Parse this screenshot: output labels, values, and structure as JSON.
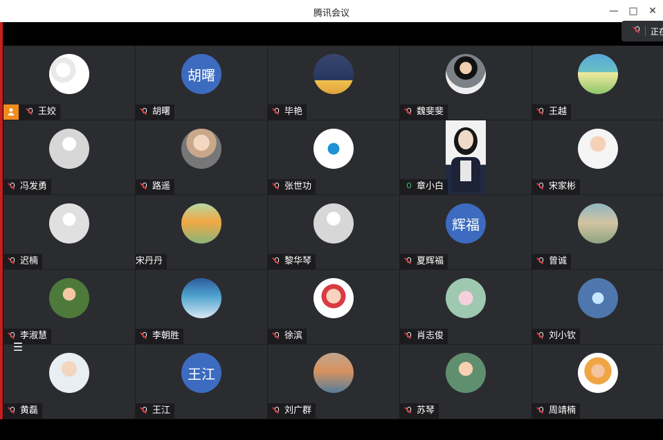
{
  "window": {
    "title": "腾讯会议",
    "min": "—",
    "max": "□",
    "close": "✕"
  },
  "status": {
    "text": "正在"
  },
  "grid": [
    {
      "name": "王姣",
      "host": true,
      "avatar": "img1",
      "mic": "muted"
    },
    {
      "name": "胡曙",
      "host": false,
      "avatar": "text",
      "avatar_text": "胡曙",
      "mic": "muted"
    },
    {
      "name": "毕艳",
      "host": false,
      "avatar": "img2",
      "mic": "muted"
    },
    {
      "name": "魏斐斐",
      "host": false,
      "avatar": "img3",
      "mic": "muted"
    },
    {
      "name": "王越",
      "host": false,
      "avatar": "img4",
      "mic": "muted"
    },
    {
      "name": "冯发勇",
      "host": false,
      "avatar": "img5",
      "mic": "muted"
    },
    {
      "name": "路遥",
      "host": false,
      "avatar": "img6",
      "mic": "muted"
    },
    {
      "name": "张世功",
      "host": false,
      "avatar": "img7",
      "mic": "muted"
    },
    {
      "name": "章小白",
      "host": false,
      "avatar": "video",
      "mic": "on"
    },
    {
      "name": "宋家彬",
      "host": false,
      "avatar": "img9",
      "mic": "muted"
    },
    {
      "name": "迟楠",
      "host": false,
      "avatar": "img10",
      "mic": "muted"
    },
    {
      "name": "宋丹丹",
      "host": false,
      "avatar": "img11",
      "mic": "none"
    },
    {
      "name": "黎华琴",
      "host": false,
      "avatar": "img5",
      "mic": "muted"
    },
    {
      "name": "夏辉福",
      "host": false,
      "avatar": "text",
      "avatar_text": "辉福",
      "mic": "muted"
    },
    {
      "name": "曾诚",
      "host": false,
      "avatar": "img12",
      "mic": "muted"
    },
    {
      "name": "李淑慧",
      "host": false,
      "avatar": "img13",
      "mic": "muted"
    },
    {
      "name": "李朝胜",
      "host": false,
      "avatar": "img14",
      "mic": "muted"
    },
    {
      "name": "徐滨",
      "host": false,
      "avatar": "img15",
      "mic": "muted"
    },
    {
      "name": "肖志俊",
      "host": false,
      "avatar": "img16",
      "mic": "muted"
    },
    {
      "name": "刘小钦",
      "host": false,
      "avatar": "img17",
      "mic": "muted"
    },
    {
      "name": "黄磊",
      "host": false,
      "avatar": "img18",
      "mic": "muted"
    },
    {
      "name": "王江",
      "host": false,
      "avatar": "text",
      "avatar_text": "王江",
      "mic": "muted"
    },
    {
      "name": "刘广群",
      "host": false,
      "avatar": "img20",
      "mic": "muted"
    },
    {
      "name": "苏琴",
      "host": false,
      "avatar": "img21",
      "mic": "muted"
    },
    {
      "name": "周靖楠",
      "host": false,
      "avatar": "img22",
      "mic": "muted"
    }
  ],
  "menu_icon": "list-icon"
}
